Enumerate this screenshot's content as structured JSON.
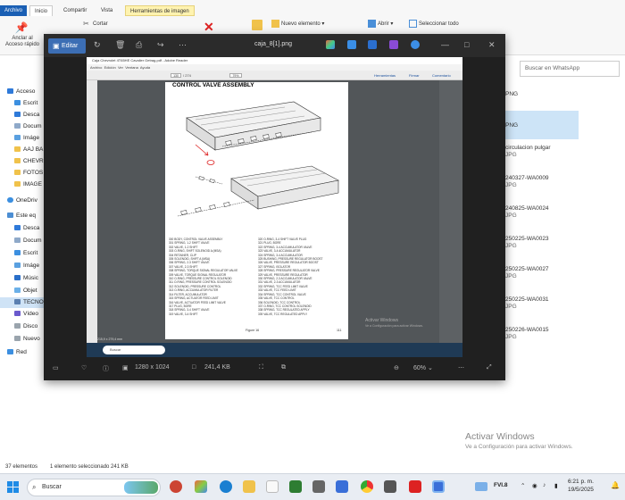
{
  "ribbon": {
    "tabs": {
      "file": "Archivo",
      "home": "Inicio",
      "share": "Compartir",
      "view": "Vista",
      "image_tools": "Herramientas de imagen"
    },
    "pin_quick_access": "Anclar al Acceso rápido",
    "cut": "Cortar",
    "new_item": "Nuevo elemento",
    "open": "Abrir",
    "select_all": "Seleccionar todo"
  },
  "nav": {
    "items": [
      "Acceso",
      "Escrit",
      "Desca",
      "Docum",
      "Imáge",
      "AAJ BA",
      "CHEVR",
      "FOTOS",
      "IMAGE",
      "OneDriv",
      "Este eq",
      "Desca",
      "Docum",
      "Escrit",
      "Imáge",
      "Músic",
      "Objet",
      "TECNO",
      "Vídeo",
      "Disco",
      "Nuevo",
      "Red"
    ]
  },
  "explorer_right": {
    "search_placeholder": "Buscar en WhatsApp",
    "files": [
      {
        "name": "PNG",
        "type": ""
      },
      {
        "name": "PNG",
        "type": ""
      },
      {
        "name": "circulacion pulgar",
        "type": "JPG"
      },
      {
        "name": "240327-WA0009",
        "type": "JPG"
      },
      {
        "name": "240825-WA0024",
        "type": "JPG"
      },
      {
        "name": "250225-WA0023",
        "type": "JPG"
      },
      {
        "name": "250225-WA0027",
        "type": "JPG"
      },
      {
        "name": "250225-WA0031",
        "type": "JPG"
      },
      {
        "name": "250226-WA0015",
        "type": "JPG"
      }
    ]
  },
  "viewer": {
    "edit_label": "Editar",
    "title": "caja_8[1].png",
    "dimensions": "1280 x 1024",
    "file_size": "241,4 KB",
    "zoom": "60%"
  },
  "acrobat": {
    "title": "Caja Chevrolet 4T65HE Cavalier Getrag.pdf - Adobe Reader",
    "menu": [
      "Archivo",
      "Edición",
      "Ver",
      "Ventana",
      "Ayuda"
    ],
    "page_field": "130",
    "page_total": "/ 274",
    "zoom": "79%",
    "tools": [
      "Herramientas",
      "Firmar",
      "Comentario"
    ],
    "heading": "CONTROL VALVE ASSEMBLY",
    "legend_left": [
      "300 BODY, CONTROL VALVE ASSEMBLY",
      "301 SPRING, 1-2 SHIFT VALVE",
      "302 VALVE, 1-2 SHIFT",
      "303 O-RING, SHIFT SOLENOID A (MSA)",
      "304 RETAINER, CLIP",
      "305 SOLENOID, SHIFT A (MSA)",
      "306 SPRING, 2-3 SHIFT VALVE",
      "307 VALVE, 2-3 SHIFT",
      "308 SPRING, TORQUE SIGNAL REGULATOR VALVE",
      "309 VALVE, TORQUE SIGNAL REGULATOR",
      "310 O-RING, PRESSURE CONTROL SOLENOID",
      "311 O-RING, PRESSURE CONTROL SOLENOID",
      "312 SOLENOID, PRESSURE CONTROL",
      "313 O-RING, ACCUMULATOR FILTER",
      "314 FILTER, ACCUMULATOR",
      "315 SPRING, ACTUATOR FEED LIMIT",
      "316 VALVE, ACTUATOR FEED LIMIT VALVE",
      "317 PLUG, BORE",
      "318 SPRING, 3-4 SHIFT VALVE",
      "319 VALVE, 3-4 SHIFT"
    ],
    "legend_right": [
      "320 O-RING, 3-4 SHIFT VALVE PLUG",
      "321 PLUG, BORE",
      "322 SPRING, 3-4 ACCUMULATOR VALVE",
      "323 VALVE, 3-4 ACCUMULATOR",
      "324 SPRING, 3-4 ACCUMULATOR",
      "325 BUSHING, PRESSURE REGULATOR BOOST",
      "326 VALVE, PRESSURE REGULATOR BOOST",
      "327 SPRING, ISOLATOR",
      "328 SPRING, PRESSURE REGULATOR VALVE",
      "329 VALVE, PRESSURE REGULATOR",
      "330 SPRING, 2-3 ACCUMULATOR VALVE",
      "331 VALVE, 2-3 ACCUMULATOR",
      "332 SPRING, TCC FEED LIMIT VALVE",
      "333 VALVE, TCC FEED LIMIT",
      "334 SPRING, TCC CONTROL VALVE",
      "335 VALVE, TCC CONTROL",
      "336 SOLENOID, TCC CONTROL",
      "337 O-RING, TCC CONTROL SOLENOID",
      "338 SPRING, TCC REGULATED APPLY",
      "339 VALVE, TCC REGULATED APPLY"
    ],
    "figure_caption": "Figure 16",
    "page_number": "111",
    "watermark_title": "Activar Windows",
    "watermark_sub": "Ve a Configuración para activar Windows.",
    "taskbar_search": "Buscar",
    "page_size": "215,9 x 279,4 mm"
  },
  "status": {
    "count": "37 elementos",
    "selected": "1 elemento seleccionado 241 KB"
  },
  "watermark": {
    "title": "Activar Windows",
    "sub": "Ve a Configuración para activar Windows."
  },
  "taskbar": {
    "search": "Buscar",
    "lang": "FVI.8",
    "time": "6:21 p. m.",
    "date": "19/5/2025"
  }
}
